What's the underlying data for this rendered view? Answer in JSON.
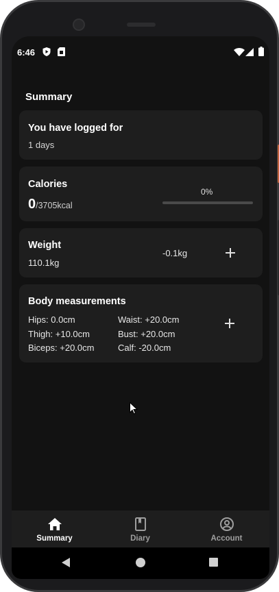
{
  "status_bar": {
    "time": "6:46"
  },
  "summary": {
    "title": "Summary"
  },
  "logged_card": {
    "title": "You have logged for",
    "value": "1 days"
  },
  "calories_card": {
    "title": "Calories",
    "consumed": "0",
    "goal": "/3705kcal",
    "percent_label": "0%",
    "progress": 0
  },
  "weight_card": {
    "title": "Weight",
    "value": "110.1kg",
    "change": "-0.1kg"
  },
  "body_card": {
    "title": "Body measurements",
    "hips": "Hips: 0.0cm",
    "waist": "Waist: +20.0cm",
    "thigh": "Thigh: +10.0cm",
    "bust": "Bust: +20.0cm",
    "biceps": "Biceps: +20.0cm",
    "calf": "Calf: -20.0cm"
  },
  "bottom_nav": {
    "items": [
      {
        "label": "Summary",
        "icon": "home-icon",
        "active": true
      },
      {
        "label": "Diary",
        "icon": "book-icon",
        "active": false
      },
      {
        "label": "Account",
        "icon": "account-circle-icon",
        "active": false
      }
    ]
  },
  "system_nav": {
    "icons": [
      "back-icon",
      "home-circle-icon",
      "recents-icon"
    ]
  },
  "colors": {
    "background": "#121212",
    "card": "#1e1e1e",
    "text_primary": "#ffffff",
    "text_inactive": "#9e9e9e"
  }
}
